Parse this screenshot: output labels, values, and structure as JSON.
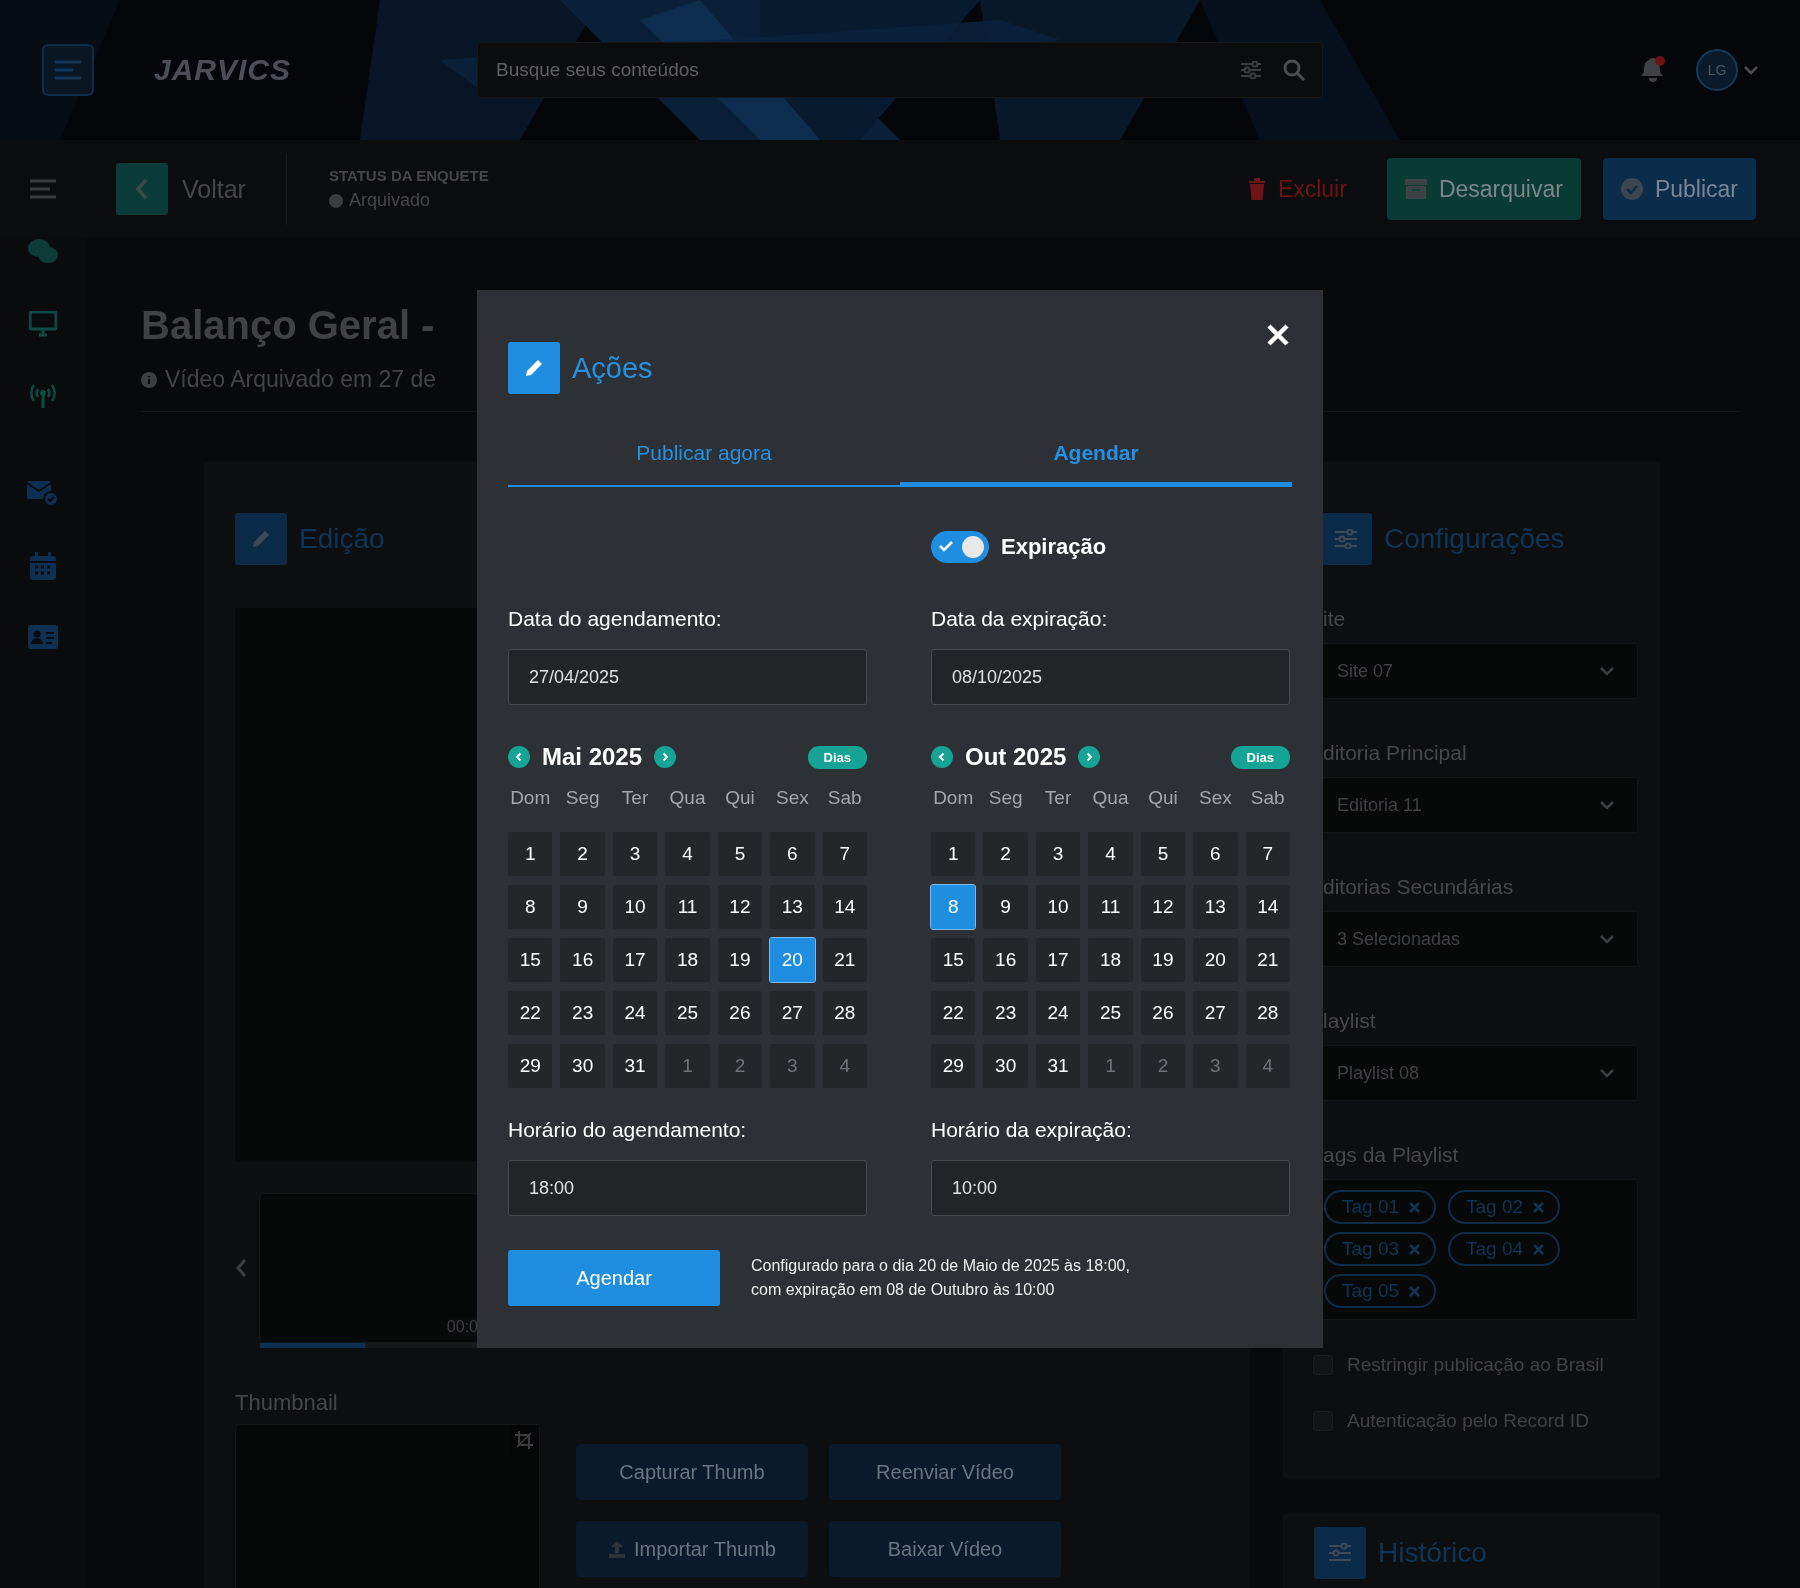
{
  "header": {
    "logo": "JARVICS",
    "search": {
      "placeholder": "Busque seus conteúdos"
    },
    "notifications": {
      "unread": true
    },
    "avatar": "LG"
  },
  "toolbar": {
    "back": "Voltar",
    "status_label": "STATUS DA ENQUETE",
    "status": "Arquivado",
    "actions": [
      {
        "kind": "delete",
        "label": "Excluir"
      },
      {
        "kind": "unarchive",
        "label": "Desarquivar"
      },
      {
        "kind": "publish",
        "label": "Publicar"
      }
    ]
  },
  "page": {
    "title": "Balanço Geral -",
    "info": "Vídeo Arquivado em 27 de"
  },
  "edit_card": {
    "title": "Edição",
    "timecode": "00:0",
    "thumbnail_label": "Thumbnail",
    "buttons": [
      {
        "kind": "plain",
        "label": "Capturar Thumb"
      },
      {
        "kind": "plain",
        "label": "Reenviar Vídeo"
      },
      {
        "kind": "upload",
        "label": "Importar Thumb"
      },
      {
        "kind": "plain",
        "label": "Baixar Vídeo"
      }
    ]
  },
  "config_card": {
    "title": "Configurações",
    "selects": [
      {
        "label": "ite",
        "value": "Site 07"
      },
      {
        "label": "ditoria Principal",
        "value": "Editoria 11"
      },
      {
        "label": "ditorias Secundárias",
        "value": "3 Selecionadas"
      },
      {
        "label": "laylist",
        "value": "Playlist 08"
      }
    ],
    "tags_label": "ags da Playlist",
    "tags": [
      "Tag 01",
      "Tag 02",
      "Tag 03",
      "Tag 04",
      "Tag 05"
    ],
    "checkboxes": [
      {
        "label": "Restringir publicação ao Brasil",
        "checked": false
      },
      {
        "label": "Autenticação pelo Record ID",
        "checked": false
      }
    ]
  },
  "history_card": {
    "title": "Histórico"
  },
  "modal": {
    "title": "Ações",
    "tabs": [
      {
        "label": "Publicar agora",
        "selected": false
      },
      {
        "label": "Agendar",
        "selected": true
      }
    ],
    "expiration": {
      "label": "Expiração",
      "on": true
    },
    "columns": [
      {
        "date_label": "Data do agendamento:",
        "date_value": "27/04/2025",
        "calendar": {
          "month": "Mai 2025",
          "mode": "Dias",
          "weekdays": [
            "Dom",
            "Seg",
            "Ter",
            "Qua",
            "Qui",
            "Sex",
            "Sab"
          ],
          "days": [
            {
              "label": "1",
              "selected": false,
              "outside": false
            },
            {
              "label": "2",
              "selected": false,
              "outside": false
            },
            {
              "label": "3",
              "selected": false,
              "outside": false
            },
            {
              "label": "4",
              "selected": false,
              "outside": false
            },
            {
              "label": "5",
              "selected": false,
              "outside": false
            },
            {
              "label": "6",
              "selected": false,
              "outside": false
            },
            {
              "label": "7",
              "selected": false,
              "outside": false
            },
            {
              "label": "8",
              "selected": false,
              "outside": false
            },
            {
              "label": "9",
              "selected": false,
              "outside": false
            },
            {
              "label": "10",
              "selected": false,
              "outside": false
            },
            {
              "label": "11",
              "selected": false,
              "outside": false
            },
            {
              "label": "12",
              "selected": false,
              "outside": false
            },
            {
              "label": "13",
              "selected": false,
              "outside": false
            },
            {
              "label": "14",
              "selected": false,
              "outside": false
            },
            {
              "label": "15",
              "selected": false,
              "outside": false
            },
            {
              "label": "16",
              "selected": false,
              "outside": false
            },
            {
              "label": "17",
              "selected": false,
              "outside": false
            },
            {
              "label": "18",
              "selected": false,
              "outside": false
            },
            {
              "label": "19",
              "selected": false,
              "outside": false
            },
            {
              "label": "20",
              "selected": true,
              "outside": false
            },
            {
              "label": "21",
              "selected": false,
              "outside": false
            },
            {
              "label": "22",
              "selected": false,
              "outside": false
            },
            {
              "label": "23",
              "selected": false,
              "outside": false
            },
            {
              "label": "24",
              "selected": false,
              "outside": false
            },
            {
              "label": "25",
              "selected": false,
              "outside": false
            },
            {
              "label": "26",
              "selected": false,
              "outside": false
            },
            {
              "label": "27",
              "selected": false,
              "outside": false
            },
            {
              "label": "28",
              "selected": false,
              "outside": false
            },
            {
              "label": "29",
              "selected": false,
              "outside": false
            },
            {
              "label": "30",
              "selected": false,
              "outside": false
            },
            {
              "label": "31",
              "selected": false,
              "outside": false
            },
            {
              "label": "1",
              "selected": false,
              "outside": true
            },
            {
              "label": "2",
              "selected": false,
              "outside": true
            },
            {
              "label": "3",
              "selected": false,
              "outside": true
            },
            {
              "label": "4",
              "selected": false,
              "outside": true
            }
          ]
        },
        "time_label": "Horário do agendamento:",
        "time_value": "18:00"
      },
      {
        "date_label": "Data da expiração:",
        "date_value": "08/10/2025",
        "calendar": {
          "month": "Out 2025",
          "mode": "Dias",
          "weekdays": [
            "Dom",
            "Seg",
            "Ter",
            "Qua",
            "Qui",
            "Sex",
            "Sab"
          ],
          "days": [
            {
              "label": "1",
              "selected": false,
              "outside": false
            },
            {
              "label": "2",
              "selected": false,
              "outside": false
            },
            {
              "label": "3",
              "selected": false,
              "outside": false
            },
            {
              "label": "4",
              "selected": false,
              "outside": false
            },
            {
              "label": "5",
              "selected": false,
              "outside": false
            },
            {
              "label": "6",
              "selected": false,
              "outside": false
            },
            {
              "label": "7",
              "selected": false,
              "outside": false
            },
            {
              "label": "8",
              "selected": true,
              "outside": false
            },
            {
              "label": "9",
              "selected": false,
              "outside": false
            },
            {
              "label": "10",
              "selected": false,
              "outside": false
            },
            {
              "label": "11",
              "selected": false,
              "outside": false
            },
            {
              "label": "12",
              "selected": false,
              "outside": false
            },
            {
              "label": "13",
              "selected": false,
              "outside": false
            },
            {
              "label": "14",
              "selected": false,
              "outside": false
            },
            {
              "label": "15",
              "selected": false,
              "outside": false
            },
            {
              "label": "16",
              "selected": false,
              "outside": false
            },
            {
              "label": "17",
              "selected": false,
              "outside": false
            },
            {
              "label": "18",
              "selected": false,
              "outside": false
            },
            {
              "label": "19",
              "selected": false,
              "outside": false
            },
            {
              "label": "20",
              "selected": false,
              "outside": false
            },
            {
              "label": "21",
              "selected": false,
              "outside": false
            },
            {
              "label": "22",
              "selected": false,
              "outside": false
            },
            {
              "label": "23",
              "selected": false,
              "outside": false
            },
            {
              "label": "24",
              "selected": false,
              "outside": false
            },
            {
              "label": "25",
              "selected": false,
              "outside": false
            },
            {
              "label": "26",
              "selected": false,
              "outside": false
            },
            {
              "label": "27",
              "selected": false,
              "outside": false
            },
            {
              "label": "28",
              "selected": false,
              "outside": false
            },
            {
              "label": "29",
              "selected": false,
              "outside": false
            },
            {
              "label": "30",
              "selected": false,
              "outside": false
            },
            {
              "label": "31",
              "selected": false,
              "outside": false
            },
            {
              "label": "1",
              "selected": false,
              "outside": true
            },
            {
              "label": "2",
              "selected": false,
              "outside": true
            },
            {
              "label": "3",
              "selected": false,
              "outside": true
            },
            {
              "label": "4",
              "selected": false,
              "outside": true
            }
          ]
        },
        "time_label": "Horário da expiração:",
        "time_value": "10:00"
      }
    ],
    "submit": "Agendar",
    "summary": [
      "Configurado para o dia 20 de Maio de 2025 às 18:00,",
      "com expiração em 08 de Outubro às 10:00"
    ]
  }
}
